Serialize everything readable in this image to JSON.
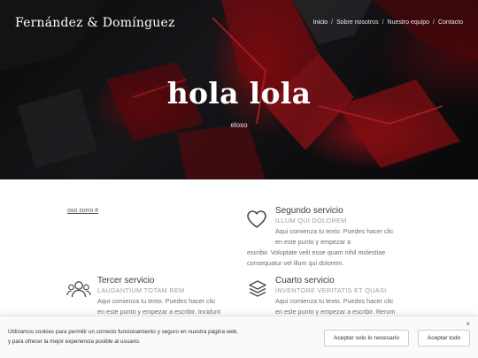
{
  "header": {
    "brand": "Fernández & Domínguez",
    "nav": [
      {
        "label": "Inicio",
        "active": true
      },
      {
        "label": "Sobre nosotros",
        "active": false
      },
      {
        "label": "Nuestro equipo",
        "active": false
      },
      {
        "label": "Contacto",
        "active": false
      }
    ],
    "separator": "/"
  },
  "hero": {
    "title": "hola lola",
    "subtitle": "eloso"
  },
  "content": {
    "link": "oso zorro #",
    "services": [
      {
        "title": "Segundo servicio",
        "subtitle": "ILLUM QUI DOLOREM",
        "text_lines": [
          "Aqui comienza tu texto. Puedes hacer clic",
          "en este punto y empezar a"
        ],
        "text_full_lines": [
          "escribir. Voluptate velit esse quam nihil molestiae",
          "consequatur vel illum qui dolorem."
        ],
        "icon": "heart-icon"
      },
      {
        "title": "Tercer servicio",
        "subtitle": "LAUDANTIUM TOTAM REM",
        "text_lines": [
          "Aqui comienza tu texto. Puedes hacer clic",
          "en este punto y empezar a escribir. Incidunt"
        ],
        "icon": "users-icon"
      },
      {
        "title": "Cuarto servicio",
        "subtitle": "INVENTORE VERITATIS ET QUASI",
        "text_lines": [
          "Aqui comienza tu texto. Puedes hacer clic",
          "en este punto y empezar a escribir. Rerum"
        ],
        "icon": "layers-icon"
      }
    ]
  },
  "cookie": {
    "text_line1": "Utilizamos cookies para permitir un correcto funcionamiento y seguro en nuestra página web,",
    "text_line2": "y para ofrecer la mejor experiencia posible al usuario.",
    "close": "×",
    "btn_necessary": "Aceptar solo lo necesario",
    "btn_all": "Aceptar todo"
  },
  "colors": {
    "hero_red": "#c0141b",
    "hero_dark": "#111114",
    "muted_subtitle": "#9aa0a0"
  }
}
